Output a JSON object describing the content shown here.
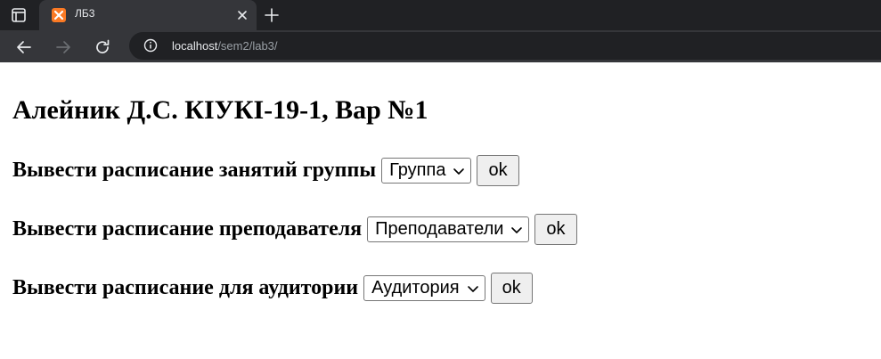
{
  "browser": {
    "tab": {
      "title": "ЛБ3"
    },
    "url": {
      "host": "localhost",
      "path": "/sem2/lab3/"
    },
    "colors": {
      "favicon": "#fb7a24",
      "tab_bg": "#35363a",
      "frame_bg": "#202124"
    }
  },
  "page": {
    "title": "Алейник Д.С. КІУКІ-19-1, Вар №1",
    "forms": [
      {
        "label": "Вывести расписание занятий группы",
        "select_value": "Группа",
        "button": "ok"
      },
      {
        "label": "Вывести расписание преподавателя",
        "select_value": "Преподаватели",
        "button": "ok"
      },
      {
        "label": "Вывести расписание для аудитории",
        "select_value": "Аудитория",
        "button": "ok"
      }
    ]
  },
  "icons": {
    "tab_actions": "tab-actions-icon",
    "close": "close-icon",
    "new_tab": "plus-icon",
    "back": "arrow-left-icon",
    "forward": "arrow-right-icon",
    "reload": "reload-icon",
    "site_info": "info-icon",
    "dropdown": "chevron-down-icon"
  }
}
